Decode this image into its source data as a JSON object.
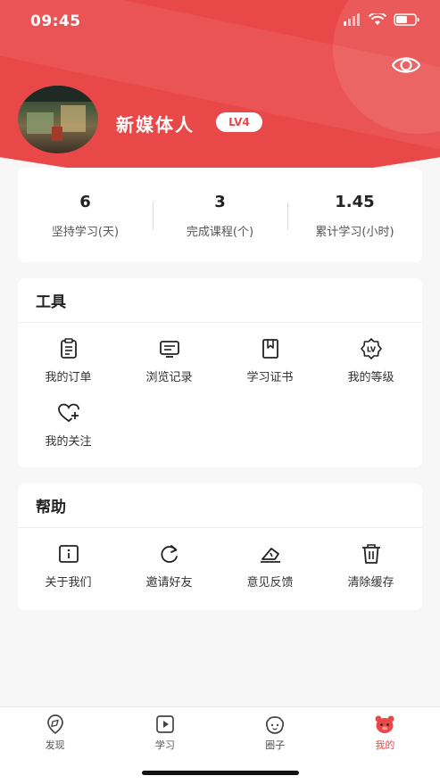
{
  "status_bar": {
    "time": "09:45"
  },
  "profile": {
    "name": "新媒体人",
    "level": "LV4"
  },
  "stats": [
    {
      "value": "6",
      "label": "坚持学习(天)"
    },
    {
      "value": "3",
      "label": "完成课程(个)"
    },
    {
      "value": "1.45",
      "label": "累计学习(小时)"
    }
  ],
  "tools": {
    "title": "工具",
    "items": [
      {
        "label": "我的订单",
        "icon": "clipboard-icon"
      },
      {
        "label": "浏览记录",
        "icon": "monitor-icon"
      },
      {
        "label": "学习证书",
        "icon": "bookmark-icon"
      },
      {
        "label": "我的等级",
        "icon": "level-badge-icon"
      },
      {
        "label": "我的关注",
        "icon": "heart-plus-icon"
      }
    ]
  },
  "help": {
    "title": "帮助",
    "items": [
      {
        "label": "关于我们",
        "icon": "info-icon"
      },
      {
        "label": "邀请好友",
        "icon": "share-icon"
      },
      {
        "label": "意见反馈",
        "icon": "feedback-icon"
      },
      {
        "label": "清除缓存",
        "icon": "trash-icon"
      }
    ]
  },
  "tabbar": [
    {
      "label": "发现",
      "icon": "discover-icon",
      "active": false
    },
    {
      "label": "学习",
      "icon": "play-icon",
      "active": false
    },
    {
      "label": "圈子",
      "icon": "circle-face-icon",
      "active": false
    },
    {
      "label": "我的",
      "icon": "bear-icon",
      "active": true
    }
  ],
  "colors": {
    "accent": "#e94848",
    "background": "#f7f7f7"
  }
}
